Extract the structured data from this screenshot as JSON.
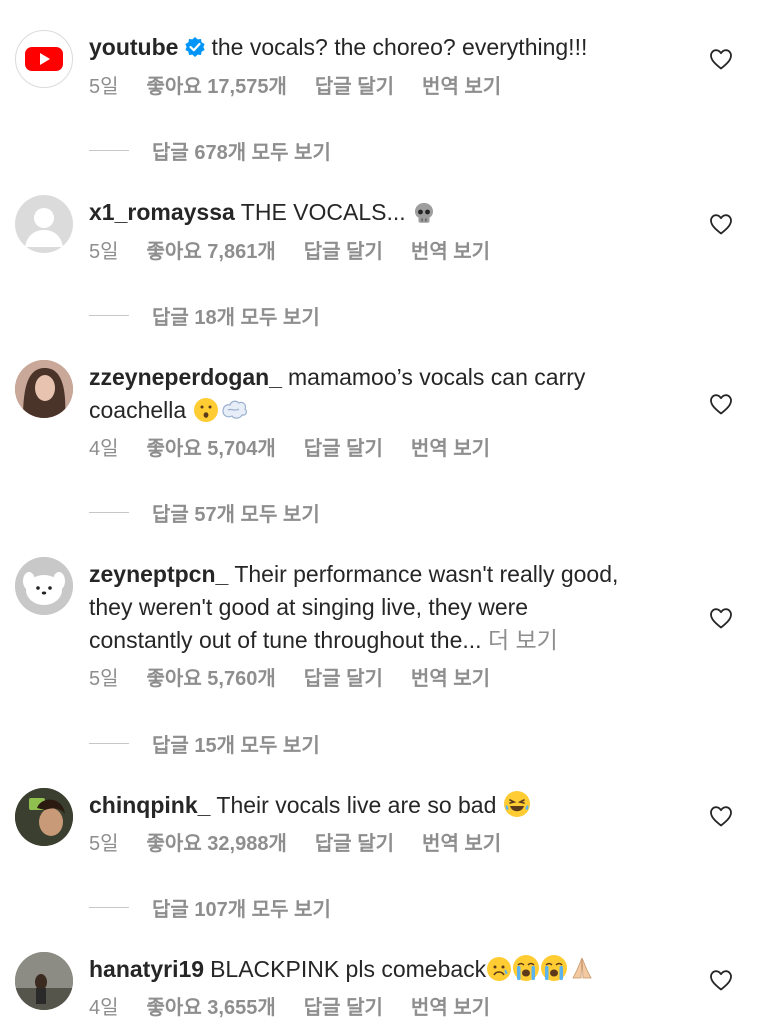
{
  "comments": [
    {
      "username": "youtube",
      "verified": true,
      "text": "the vocals? the choreo? everything!!!",
      "time": "5일",
      "likes": "좋아요 17,575개",
      "reply": "답글 달기",
      "translate": "번역 보기",
      "replies": "답글 678개 모두 보기"
    },
    {
      "username": "x1_romayssa",
      "text": "THE VOCALS...",
      "time": "5일",
      "likes": "좋아요 7,861개",
      "reply": "답글 달기",
      "translate": "번역 보기",
      "replies": "답글 18개 모두 보기"
    },
    {
      "username": "zzeyneperdogan_",
      "text_line1": "mamamoo’s vocals can carry",
      "text_line2": "coachella",
      "time": "4일",
      "likes": "좋아요 5,704개",
      "reply": "답글 달기",
      "translate": "번역 보기",
      "replies": "답글 57개 모두 보기"
    },
    {
      "username": "zeyneptpcn_",
      "text_line1": "Their performance wasn't really good,",
      "text_line2": "they weren't good at singing live, they were",
      "text_line3": "constantly out of tune throughout the...",
      "more": "더 보기",
      "time": "5일",
      "likes": "좋아요 5,760개",
      "reply": "답글 달기",
      "translate": "번역 보기",
      "replies": "답글 15개 모두 보기"
    },
    {
      "username": "chinqpink_",
      "text": "Their vocals live are so bad",
      "time": "5일",
      "likes": "좋아요 32,988개",
      "reply": "답글 달기",
      "translate": "번역 보기",
      "replies": "답글 107개 모두 보기"
    },
    {
      "username": "hanatyri19",
      "text": "BLACKPINK pls comeback",
      "time": "4일",
      "likes": "좋아요 3,655개",
      "reply": "답글 달기",
      "translate": "번역 보기"
    }
  ],
  "colors": {
    "text": "#262626",
    "secondary": "#8e8e8e",
    "verified": "#0095f6",
    "youtube_red": "#ff0000"
  },
  "icons": [
    "youtube-logo",
    "verified-badge-icon",
    "heart-icon",
    "skull-emoji",
    "hushed-face-emoji",
    "dash-emoji",
    "laughing-emoji",
    "sad-face-emoji",
    "crying-face-emoji",
    "praying-hands-emoji"
  ]
}
